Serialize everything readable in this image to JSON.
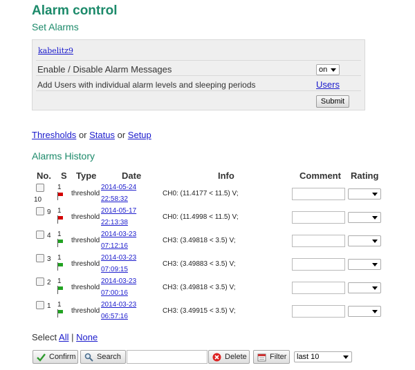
{
  "page": {
    "title": "Alarm control",
    "subtitle": "Set Alarms"
  },
  "panel": {
    "user": "kabelitz9",
    "enable_label": "Enable / Disable Alarm Messages",
    "enable_value": "on",
    "users_label": "Add Users with individual alarm levels and sleeping periods",
    "users_link": "Users",
    "submit_label": "Submit"
  },
  "nav": {
    "thresholds": "Thresholds",
    "or1": "or",
    "status": "Status",
    "or2": "or",
    "setup": "Setup"
  },
  "history": {
    "title": "Alarms History",
    "headers": {
      "no": "No.",
      "s": "S",
      "type": "Type",
      "date": "Date",
      "info": "Info",
      "comment": "Comment",
      "rating": "Rating"
    },
    "rows": [
      {
        "no": "10",
        "s": "1",
        "flag": "red",
        "type": "threshold",
        "date1": "2014-05-24",
        "date2": "22:58:32",
        "info": "CH0: (11.4177 < 11.5) V;"
      },
      {
        "no": "9",
        "s": "1",
        "flag": "red",
        "type": "threshold",
        "date1": "2014-05-17",
        "date2": "22:13:38",
        "info": "CH0: (11.4998 < 11.5) V;"
      },
      {
        "no": "4",
        "s": "1",
        "flag": "green",
        "type": "threshold",
        "date1": "2014-03-23",
        "date2": "07:12:16",
        "info": "CH3: (3.49818 < 3.5) V;"
      },
      {
        "no": "3",
        "s": "1",
        "flag": "green",
        "type": "threshold",
        "date1": "2014-03-23",
        "date2": "07:09:15",
        "info": "CH3: (3.49883 < 3.5) V;"
      },
      {
        "no": "2",
        "s": "1",
        "flag": "green",
        "type": "threshold",
        "date1": "2014-03-23",
        "date2": "07:00:16",
        "info": "CH3: (3.49818 < 3.5) V;"
      },
      {
        "no": "1",
        "s": "1",
        "flag": "green",
        "type": "threshold",
        "date1": "2014-03-23",
        "date2": "06:57:16",
        "info": "CH3: (3.49915 < 3.5) V;"
      }
    ]
  },
  "select": {
    "label": "Select",
    "all": "All",
    "sep": "|",
    "none": "None"
  },
  "toolbar": {
    "confirm": "Confirm",
    "search": "Search",
    "search_value": "",
    "delete": "Delete",
    "filter": "Filter",
    "range": "last 10"
  },
  "colors": {
    "heading": "#1c8a6a",
    "link": "#1a1acc",
    "flag_red": "#d40000",
    "flag_green": "#22a322"
  },
  "icons": {
    "confirm": "check-icon",
    "search": "magnifier-icon",
    "delete": "x-icon",
    "filter": "calendar-icon"
  }
}
